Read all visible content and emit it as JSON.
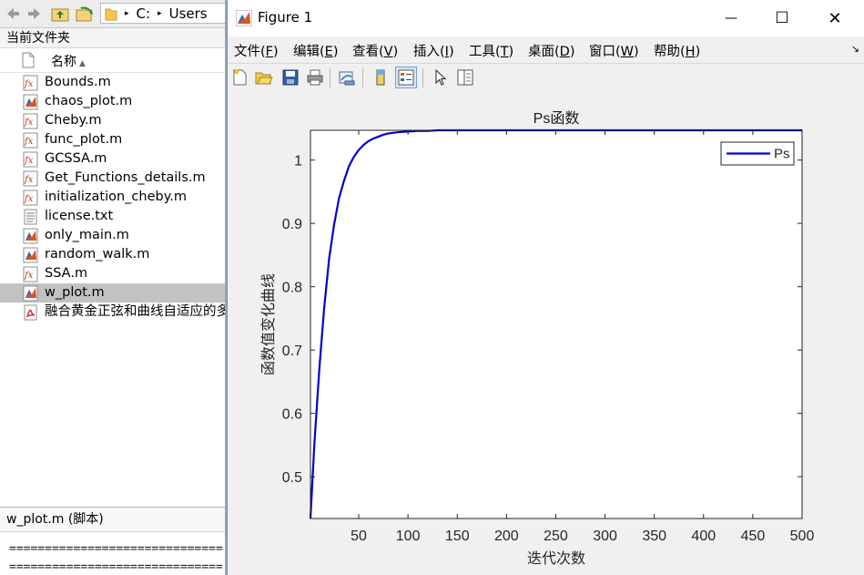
{
  "left_pane": {
    "nav": {
      "path_segments": [
        "C:",
        "Users"
      ],
      "path_separator": "▸"
    },
    "folder_header": "当前文件夹",
    "column_name": "名称",
    "files": [
      {
        "name": "Bounds.m",
        "icon": "matlab-function-icon",
        "selected": false
      },
      {
        "name": "chaos_plot.m",
        "icon": "matlab-script-icon",
        "selected": false
      },
      {
        "name": "Cheby.m",
        "icon": "matlab-function-icon",
        "selected": false
      },
      {
        "name": "func_plot.m",
        "icon": "matlab-function-icon",
        "selected": false
      },
      {
        "name": "GCSSA.m",
        "icon": "matlab-function-icon",
        "selected": false
      },
      {
        "name": "Get_Functions_details.m",
        "icon": "matlab-function-icon",
        "selected": false
      },
      {
        "name": "initialization_cheby.m",
        "icon": "matlab-function-icon",
        "selected": false
      },
      {
        "name": "license.txt",
        "icon": "text-file-icon",
        "selected": false
      },
      {
        "name": "only_main.m",
        "icon": "matlab-script-icon",
        "selected": false
      },
      {
        "name": "random_walk.m",
        "icon": "matlab-script-icon",
        "selected": false
      },
      {
        "name": "SSA.m",
        "icon": "matlab-function-icon",
        "selected": false
      },
      {
        "name": "w_plot.m",
        "icon": "matlab-script-icon",
        "selected": true
      },
      {
        "name": "融合黄金正弦和曲线自适应的多策略麻雀搜索算法",
        "icon": "pdf-file-icon",
        "selected": false
      }
    ],
    "details": {
      "title": "w_plot.m  (脚本)",
      "lines": [
        "==============================",
        "=============================="
      ]
    }
  },
  "figure": {
    "title": "Figure 1",
    "window_controls": {
      "minimize": "—",
      "maximize": "☐",
      "close": "✕"
    },
    "menu": [
      {
        "label": "文件",
        "key": "F"
      },
      {
        "label": "编辑",
        "key": "E"
      },
      {
        "label": "查看",
        "key": "V"
      },
      {
        "label": "插入",
        "key": "I"
      },
      {
        "label": "工具",
        "key": "T"
      },
      {
        "label": "桌面",
        "key": "D"
      },
      {
        "label": "窗口",
        "key": "W"
      },
      {
        "label": "帮助",
        "key": "H"
      }
    ],
    "dock_arrow": "↘",
    "toolbar_icons": [
      "new-figure-icon",
      "open-file-icon",
      "save-icon",
      "print-icon",
      "link-plot-icon",
      "colorbar-icon",
      "legend-icon",
      "pointer-icon",
      "plot-tools-icon"
    ]
  },
  "colors": {
    "line": "#0000cd",
    "selection": "#c2c2c2"
  },
  "chart_data": {
    "type": "line",
    "title": "Ps函数",
    "xlabel": "迭代次数",
    "ylabel": "函数值变化曲线",
    "xlim": [
      1,
      500
    ],
    "ylim": [
      0.434,
      1.047
    ],
    "xticks": [
      50,
      100,
      150,
      200,
      250,
      300,
      350,
      400,
      450,
      500
    ],
    "yticks": [
      0.5,
      0.6,
      0.7,
      0.8,
      0.9,
      1
    ],
    "ytick_labels": [
      "0.5",
      "0.6",
      "0.7",
      "0.8",
      "0.9",
      "1"
    ],
    "legend": {
      "location": "top-right"
    },
    "grid": false,
    "series": [
      {
        "name": "Ps",
        "color": "#0000cd",
        "x": [
          1,
          5,
          10,
          15,
          20,
          25,
          30,
          35,
          40,
          45,
          50,
          55,
          60,
          65,
          70,
          75,
          80,
          90,
          100,
          110,
          120,
          130,
          140,
          150,
          175,
          200,
          250,
          300,
          350,
          400,
          450,
          500
        ],
        "y": [
          0.434,
          0.552,
          0.67,
          0.768,
          0.845,
          0.898,
          0.94,
          0.967,
          0.99,
          1.005,
          1.016,
          1.024,
          1.03,
          1.034,
          1.037,
          1.04,
          1.042,
          1.044,
          1.045,
          1.046,
          1.046,
          1.047,
          1.047,
          1.047,
          1.047,
          1.047,
          1.047,
          1.047,
          1.047,
          1.047,
          1.047,
          1.047
        ]
      }
    ]
  }
}
